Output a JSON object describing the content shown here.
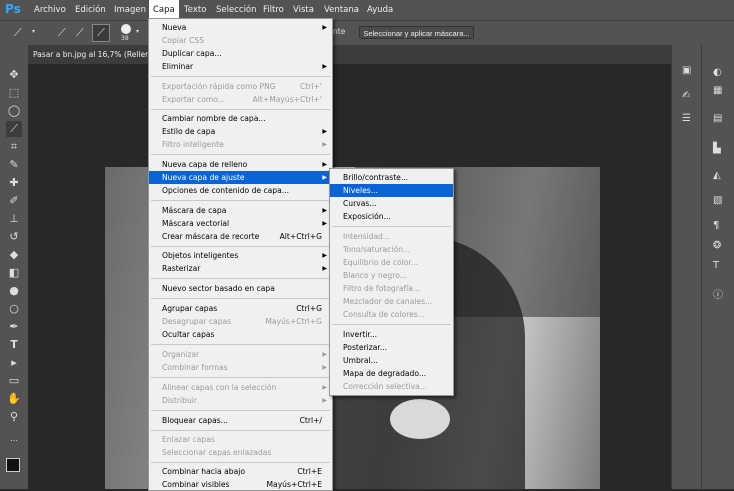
{
  "app": {
    "logo": "Ps"
  },
  "menubar": {
    "items": [
      "Archivo",
      "Edición",
      "Imagen",
      "Capa",
      "Texto",
      "Selección",
      "Filtro",
      "Vista",
      "Ventana",
      "Ayuda"
    ],
    "active": "Capa"
  },
  "options_bar": {
    "brush_size": "38",
    "partial_label": "nte",
    "select_mask_button": "Seleccionar y aplicar máscara..."
  },
  "document": {
    "tab_title": "Pasar a bn.jpg al 16,7% (Rellen"
  },
  "capa_menu": {
    "items": [
      {
        "label": "Nueva",
        "submenu": true
      },
      {
        "label": "Copiar CSS",
        "disabled": true
      },
      {
        "label": "Duplicar capa..."
      },
      {
        "label": "Eliminar",
        "submenu": true
      },
      {
        "label": "Exportación rápida como PNG",
        "shortcut": "Ctrl+'",
        "disabled": true
      },
      {
        "label": "Exportar como...",
        "shortcut": "Alt+Mayús+Ctrl+'",
        "disabled": true
      },
      {
        "label": "Cambiar nombre de capa..."
      },
      {
        "label": "Estilo de capa",
        "submenu": true
      },
      {
        "label": "Filtro inteligente",
        "submenu": true,
        "disabled": true
      },
      {
        "label": "Nueva capa de relleno",
        "submenu": true
      },
      {
        "label": "Nueva capa de ajuste",
        "submenu": true,
        "highlighted": true
      },
      {
        "label": "Opciones de contenido de capa..."
      },
      {
        "label": "Máscara de capa",
        "submenu": true
      },
      {
        "label": "Máscara vectorial",
        "submenu": true
      },
      {
        "label": "Crear máscara de recorte",
        "shortcut": "Alt+Ctrl+G"
      },
      {
        "label": "Objetos inteligentes",
        "submenu": true
      },
      {
        "label": "Rasterizar",
        "submenu": true
      },
      {
        "label": "Nuevo sector basado en capa"
      },
      {
        "label": "Agrupar capas",
        "shortcut": "Ctrl+G"
      },
      {
        "label": "Desagrupar capas",
        "shortcut": "Mayús+Ctrl+G",
        "disabled": true
      },
      {
        "label": "Ocultar capas"
      },
      {
        "label": "Organizar",
        "submenu": true,
        "disabled": true
      },
      {
        "label": "Combinar formas",
        "submenu": true,
        "disabled": true
      },
      {
        "label": "Alinear capas con la selección",
        "submenu": true,
        "disabled": true
      },
      {
        "label": "Distribuir",
        "submenu": true,
        "disabled": true
      },
      {
        "label": "Bloquear capas...",
        "shortcut": "Ctrl+/"
      },
      {
        "label": "Enlazar capas",
        "disabled": true
      },
      {
        "label": "Seleccionar capas enlazadas",
        "disabled": true
      },
      {
        "label": "Combinar hacia abajo",
        "shortcut": "Ctrl+E"
      },
      {
        "label": "Combinar visibles",
        "shortcut": "Mayús+Ctrl+E"
      }
    ]
  },
  "ajuste_submenu": {
    "items": [
      {
        "label": "Brillo/contraste..."
      },
      {
        "label": "Niveles...",
        "highlighted": true
      },
      {
        "label": "Curvas..."
      },
      {
        "label": "Exposición..."
      },
      {
        "label": "Intensidad...",
        "disabled": true
      },
      {
        "label": "Tono/saturación...",
        "disabled": true
      },
      {
        "label": "Equilibrio de color...",
        "disabled": true
      },
      {
        "label": "Blanco y negro...",
        "disabled": true
      },
      {
        "label": "Filtro de fotografía...",
        "disabled": true
      },
      {
        "label": "Mezclador de canales...",
        "disabled": true
      },
      {
        "label": "Consulta de colores...",
        "disabled": true
      },
      {
        "label": "Invertir..."
      },
      {
        "label": "Posterizar..."
      },
      {
        "label": "Umbral..."
      },
      {
        "label": "Mapa de degradado..."
      },
      {
        "label": "Corrección selectiva...",
        "disabled": true
      }
    ]
  },
  "tools": [
    "move-tool-icon",
    "marquee-tool-icon",
    "lasso-tool-icon",
    "quick-selection-tool-icon",
    "crop-tool-icon",
    "eyedropper-tool-icon",
    "healing-brush-tool-icon",
    "brush-tool-icon",
    "clone-stamp-tool-icon",
    "history-brush-tool-icon",
    "eraser-tool-icon",
    "paint-bucket-tool-icon",
    "blur-tool-icon",
    "dodge-tool-icon",
    "pen-tool-icon",
    "type-tool-icon",
    "path-selection-tool-icon",
    "rectangle-tool-icon",
    "hand-tool-icon",
    "zoom-tool-icon"
  ],
  "colors": {
    "accent": "#0a64d6",
    "photoshop_blue": "#31a8ff",
    "menu_bg": "#f0f0f0",
    "ui_gray": "#535353"
  }
}
